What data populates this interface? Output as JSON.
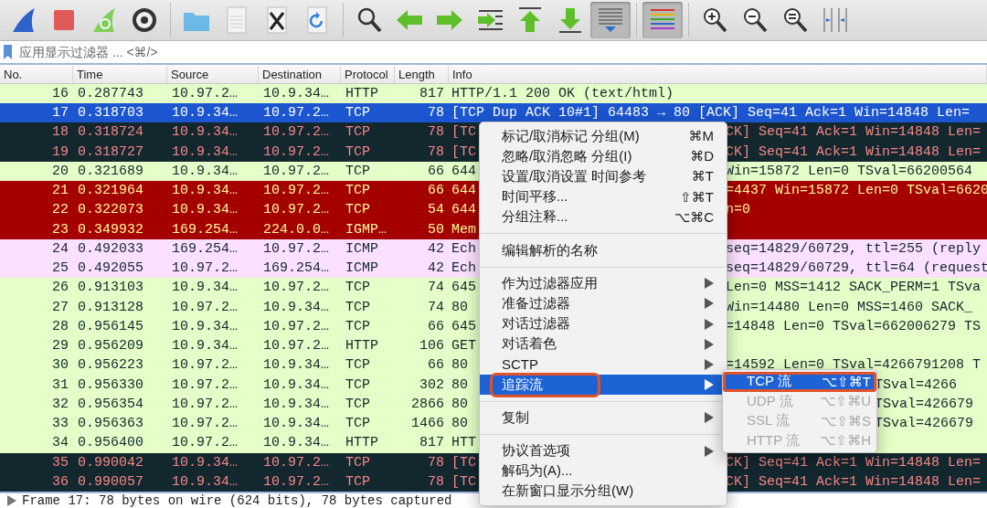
{
  "toolbar": [
    {
      "kind": "start",
      "pressed": false
    },
    {
      "kind": "stop",
      "pressed": false
    },
    {
      "kind": "restart",
      "pressed": false
    },
    {
      "kind": "options",
      "pressed": false
    },
    {
      "kind": "separator"
    },
    {
      "kind": "open",
      "pressed": false
    },
    {
      "kind": "save",
      "pressed": false
    },
    {
      "kind": "close",
      "pressed": false
    },
    {
      "kind": "reload",
      "pressed": false
    },
    {
      "kind": "separator"
    },
    {
      "kind": "find",
      "pressed": false
    },
    {
      "kind": "back",
      "pressed": false
    },
    {
      "kind": "forward",
      "pressed": false
    },
    {
      "kind": "goto",
      "pressed": false
    },
    {
      "kind": "first",
      "pressed": false
    },
    {
      "kind": "last",
      "pressed": false
    },
    {
      "kind": "autoscroll",
      "pressed": true
    },
    {
      "kind": "separator"
    },
    {
      "kind": "colorize",
      "pressed": true
    },
    {
      "kind": "separator"
    },
    {
      "kind": "zoomin",
      "pressed": false
    },
    {
      "kind": "zoomout",
      "pressed": false
    },
    {
      "kind": "zoomreset",
      "pressed": false
    },
    {
      "kind": "resize",
      "pressed": false
    }
  ],
  "filter": {
    "placeholder": "应用显示过滤器 ... <⌘/>"
  },
  "columns": [
    "No.",
    "Time",
    "Source",
    "Destination",
    "Protocol",
    "Length",
    "Info"
  ],
  "rows": [
    {
      "no": "16",
      "time": "0.287743",
      "source": "10.97.2…",
      "destination": "10.9.34…",
      "protocol": "HTTP",
      "length": "817",
      "info": "HTTP/1.1 200 OK  (text/html)",
      "kind": "normal",
      "selected": false
    },
    {
      "no": "17",
      "time": "0.318703",
      "source": "10.9.34…",
      "destination": "10.97.2…",
      "protocol": "TCP",
      "length": "78",
      "info": "[TCP Dup ACK 10#1] 64483 → 80 [ACK] Seq=41 Ack=1 Win=14848 Len=",
      "kind": "bad",
      "selected": true
    },
    {
      "no": "18",
      "time": "0.318724",
      "source": "10.9.34…",
      "destination": "10.97.2…",
      "protocol": "TCP",
      "length": "78",
      "info": "[TC",
      "info_continued": "CK] Seq=41 Ack=1 Win=14848 Len=",
      "kind": "bad",
      "selected": false
    },
    {
      "no": "19",
      "time": "0.318727",
      "source": "10.9.34…",
      "destination": "10.97.2…",
      "protocol": "TCP",
      "length": "78",
      "info": "[TC",
      "info_continued": "CK] Seq=41 Ack=1 Win=14848 Len=",
      "kind": "bad",
      "selected": false
    },
    {
      "no": "20",
      "time": "0.321689",
      "source": "10.9.34…",
      "destination": "10.97.2…",
      "protocol": "TCP",
      "length": "66",
      "info": "644",
      "info_continued": "Win=15872 Len=0 TSval=66200564",
      "kind": "normal",
      "selected": false
    },
    {
      "no": "21",
      "time": "0.321964",
      "source": "10.9.34…",
      "destination": "10.97.2…",
      "protocol": "TCP",
      "length": "66",
      "info": "644",
      "info_continued": "=4437 Win=15872 Len=0 TSval=6620",
      "kind": "error",
      "selected": false
    },
    {
      "no": "22",
      "time": "0.322073",
      "source": "10.9.34…",
      "destination": "10.97.2…",
      "protocol": "TCP",
      "length": "54",
      "info": "644",
      "info_continued": "n=0",
      "kind": "error",
      "selected": false
    },
    {
      "no": "23",
      "time": "0.349932",
      "source": "169.254…",
      "destination": "224.0.0…",
      "protocol": "IGMP…",
      "length": "50",
      "info": "Mem",
      "kind": "error",
      "selected": false
    },
    {
      "no": "24",
      "time": "0.492033",
      "source": "169.254…",
      "destination": "10.97.2…",
      "protocol": "ICMP",
      "length": "42",
      "info": "Ech",
      "info_continued": "seq=14829/60729, ttl=255 (reply",
      "kind": "icmp",
      "selected": false
    },
    {
      "no": "25",
      "time": "0.492055",
      "source": "10.97.2…",
      "destination": "169.254…",
      "protocol": "ICMP",
      "length": "42",
      "info": "Ech",
      "info_continued": "seq=14829/60729, ttl=64 (request",
      "kind": "icmp",
      "selected": false
    },
    {
      "no": "26",
      "time": "0.913103",
      "source": "10.9.34…",
      "destination": "10.97.2…",
      "protocol": "TCP",
      "length": "74",
      "info": "645",
      "info_continued": "Len=0 MSS=1412 SACK_PERM=1 TSva",
      "kind": "normal",
      "selected": false
    },
    {
      "no": "27",
      "time": "0.913128",
      "source": "10.97.2…",
      "destination": "10.9.34…",
      "protocol": "TCP",
      "length": "74",
      "info": "80",
      "info_continued": "Win=14480 Len=0 MSS=1460 SACK_",
      "kind": "normal",
      "selected": false
    },
    {
      "no": "28",
      "time": "0.956145",
      "source": "10.9.34…",
      "destination": "10.97.2…",
      "protocol": "TCP",
      "length": "66",
      "info": "645",
      "info_continued": "=14848 Len=0 TSval=662006279 TS",
      "kind": "normal",
      "selected": false
    },
    {
      "no": "29",
      "time": "0.956209",
      "source": "10.9.34…",
      "destination": "10.97.2…",
      "protocol": "HTTP",
      "length": "106",
      "info": "GET",
      "kind": "normal",
      "selected": false
    },
    {
      "no": "30",
      "time": "0.956223",
      "source": "10.97.2…",
      "destination": "10.9.34…",
      "protocol": "TCP",
      "length": "66",
      "info": "80",
      "info_continued": "=14592 Len=0 TSval=4266791208 T",
      "kind": "normal",
      "selected": false
    },
    {
      "no": "31",
      "time": "0.956330",
      "source": "10.97.2…",
      "destination": "10.9.34…",
      "protocol": "TCP",
      "length": "302",
      "info": "80",
      "info_continued": "TSval=4266",
      "kind": "normal",
      "selected": false
    },
    {
      "no": "32",
      "time": "0.956354",
      "source": "10.97.2…",
      "destination": "10.9.34…",
      "protocol": "TCP",
      "length": "2866",
      "info": "80",
      "info_continued": "TSval=426679",
      "kind": "normal",
      "selected": false
    },
    {
      "no": "33",
      "time": "0.956363",
      "source": "10.97.2…",
      "destination": "10.9.34…",
      "protocol": "TCP",
      "length": "1466",
      "info": "80",
      "info_continued": "TSval=426679",
      "kind": "normal",
      "selected": false
    },
    {
      "no": "34",
      "time": "0.956400",
      "source": "10.97.2…",
      "destination": "10.9.34…",
      "protocol": "HTTP",
      "length": "817",
      "info": "HTT",
      "kind": "normal",
      "selected": false
    },
    {
      "no": "35",
      "time": "0.990042",
      "source": "10.9.34…",
      "destination": "10.97.2…",
      "protocol": "TCP",
      "length": "78",
      "info": "[TC",
      "info_continued": "CK] Seq=41 Ack=1 Win=14848 Len=",
      "kind": "bad",
      "selected": false
    },
    {
      "no": "36",
      "time": "0.990057",
      "source": "10.9.34…",
      "destination": "10.97.2…",
      "protocol": "TCP",
      "length": "78",
      "info": "[TC",
      "info_continued": "CK] Seq=41 Ack=1 Win=14848 Len=",
      "kind": "bad",
      "selected": false
    }
  ],
  "status_bar": {
    "text": "Frame 17: 78 bytes on wire (624 bits), 78 bytes captured"
  },
  "context_menu": [
    {
      "kind": "item",
      "label": "标记/取消标记 分组(M)",
      "shortcut": "⌘M",
      "submenu": false,
      "selected": false,
      "annotated": false
    },
    {
      "kind": "item",
      "label": "忽略/取消忽略 分组(I)",
      "shortcut": "⌘D",
      "submenu": false,
      "selected": false,
      "annotated": false
    },
    {
      "kind": "item",
      "label": "设置/取消设置 时间参考",
      "shortcut": "⌘T",
      "submenu": false,
      "selected": false,
      "annotated": false
    },
    {
      "kind": "item",
      "label": "时间平移...",
      "shortcut": "⇧⌘T",
      "submenu": false,
      "selected": false,
      "annotated": false
    },
    {
      "kind": "item",
      "label": "分组注释...",
      "shortcut": "⌥⌘C",
      "submenu": false,
      "selected": false,
      "annotated": false
    },
    {
      "kind": "separator"
    },
    {
      "kind": "item",
      "label": "编辑解析的名称",
      "submenu": false,
      "selected": false,
      "annotated": false
    },
    {
      "kind": "separator"
    },
    {
      "kind": "item",
      "label": "作为过滤器应用",
      "submenu": true,
      "selected": false,
      "annotated": false
    },
    {
      "kind": "item",
      "label": "准备过滤器",
      "submenu": true,
      "selected": false,
      "annotated": false
    },
    {
      "kind": "item",
      "label": "对话过滤器",
      "submenu": true,
      "selected": false,
      "annotated": false
    },
    {
      "kind": "item",
      "label": "对话着色",
      "submenu": true,
      "selected": false,
      "annotated": false
    },
    {
      "kind": "item",
      "label": "SCTP",
      "submenu": true,
      "selected": false,
      "annotated": false
    },
    {
      "kind": "item",
      "label": "追踪流",
      "submenu": true,
      "selected": true,
      "annotated": true
    },
    {
      "kind": "separator"
    },
    {
      "kind": "item",
      "label": "复制",
      "submenu": true,
      "selected": false,
      "annotated": false
    },
    {
      "kind": "separator"
    },
    {
      "kind": "item",
      "label": "协议首选项",
      "submenu": true,
      "selected": false,
      "annotated": false
    },
    {
      "kind": "item",
      "label": "解码为(A)...",
      "submenu": false,
      "selected": false,
      "annotated": false
    },
    {
      "kind": "item",
      "label": "在新窗口显示分组(W)",
      "submenu": false,
      "selected": false,
      "annotated": false
    }
  ],
  "submenu": [
    {
      "label": "TCP 流",
      "shortcut": "⌥⇧⌘T",
      "selected": true,
      "disabled": false,
      "annotated": true
    },
    {
      "label": "UDP 流",
      "shortcut": "⌥⇧⌘U",
      "selected": false,
      "disabled": true,
      "annotated": false
    },
    {
      "label": "SSL 流",
      "shortcut": "⌥⇧⌘S",
      "selected": false,
      "disabled": true,
      "annotated": false
    },
    {
      "label": "HTTP 流",
      "shortcut": "⌥⇧⌘H",
      "selected": false,
      "disabled": true,
      "annotated": false
    }
  ]
}
